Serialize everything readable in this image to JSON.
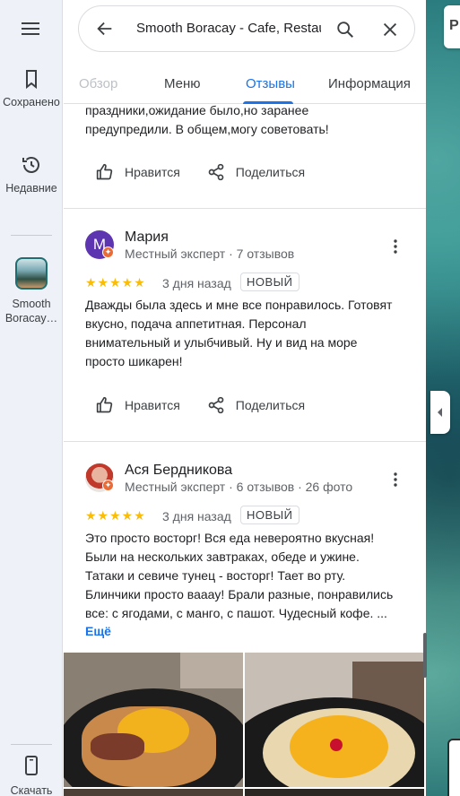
{
  "rail": {
    "saved": "Сохранено",
    "recent": "Недавние",
    "place": "Smooth Boracay…",
    "download": "Скачать"
  },
  "search": {
    "query": "Smooth Boracay - Cafe, Restaurant"
  },
  "tabs": [
    "Обзор",
    "Меню",
    "Отзывы",
    "Информация"
  ],
  "prev_review": {
    "text_line1": "праздники,ожидание было,но заранее",
    "text_line2": "предупредили. В общем,могу советовать!"
  },
  "actions": {
    "like": "Нравится",
    "share": "Поделиться"
  },
  "reviews": [
    {
      "name": "Мария",
      "initial": "М",
      "meta": "Местный эксперт · 7 отзывов",
      "stars": "★★★★★",
      "ago": "3 дня назад",
      "badge": "НОВЫЙ",
      "lines": [
        "Дважды была здесь и мне все понравилось. Готовят",
        "вкусно, подача аппетитная. Персонал",
        "внимательный и улыбчивый. Ну и вид на море",
        "просто шикарен!"
      ]
    },
    {
      "name": "Ася Бердникова",
      "meta": "Местный эксперт · 6 отзывов · 26 фото",
      "stars": "★★★★★",
      "ago": "3 дня назад",
      "badge": "НОВЫЙ",
      "lines": [
        "Это просто восторг! Вся еда невероятно вкусная!",
        "Были на нескольких завтраках, обеде и ужине.",
        "Татаки и севиче тунец - восторг! Тает во рту.",
        "Блинчики просто ваааy! Брали разные, понравились",
        "все: с ягодами, с манго, с пашот. Чудесный кофе. ..."
      ],
      "more": "Ещё"
    }
  ],
  "colors": {
    "accent": "#1a73e8",
    "star": "#fbbc04",
    "avatar_m": "#5e35b1"
  }
}
